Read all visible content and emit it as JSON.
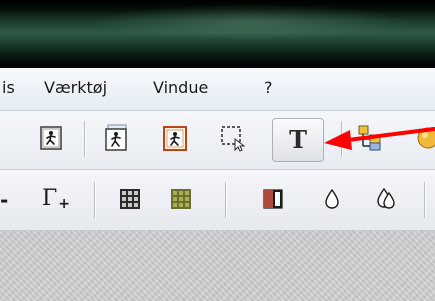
{
  "menu": {
    "items": [
      {
        "label": "is"
      },
      {
        "label": "Værktøj"
      },
      {
        "label": "Vindue"
      },
      {
        "label": "?"
      }
    ]
  },
  "toolbar1": {
    "text_tool": {
      "glyph": "T"
    }
  },
  "toolbar2": {
    "partial_glyph": "-",
    "gamma": {
      "glyph": "Γ",
      "plus": "+"
    }
  },
  "colors": {
    "annotation_arrow": "#ff0000",
    "title_bar": "#1a3a2b",
    "menu_bar": "#eef2f7"
  }
}
